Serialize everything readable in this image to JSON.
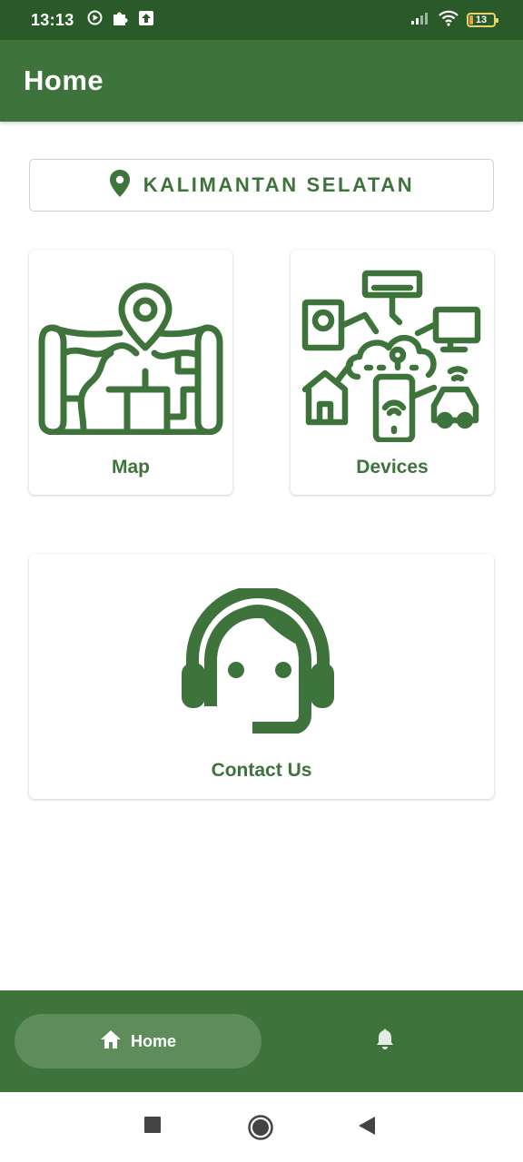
{
  "status_bar": {
    "time": "13:13",
    "battery": "13",
    "icons": [
      "media-play-icon",
      "puzzle-icon",
      "upload-icon",
      "signal-icon",
      "wifi-icon",
      "battery-icon"
    ]
  },
  "app_bar": {
    "title": "Home"
  },
  "region": {
    "label": "KALIMANTAN SELATAN",
    "icon": "location-pin-icon"
  },
  "cards": {
    "map": {
      "label": "Map",
      "icon": "map-icon"
    },
    "devices": {
      "label": "Devices",
      "icon": "iot-devices-icon"
    },
    "contact": {
      "label": "Contact Us",
      "icon": "customer-support-icon"
    }
  },
  "bottom_nav": {
    "home_label": "Home",
    "home_icon": "home-icon",
    "notifications_icon": "bell-icon"
  },
  "system_nav": [
    "recents-square-icon",
    "home-circle-icon",
    "back-triangle-icon"
  ],
  "colors": {
    "primary": "#3e733c",
    "status_bar": "#2a5a2a",
    "nav_active": "#5e8c5b",
    "background": "#ffffff"
  }
}
